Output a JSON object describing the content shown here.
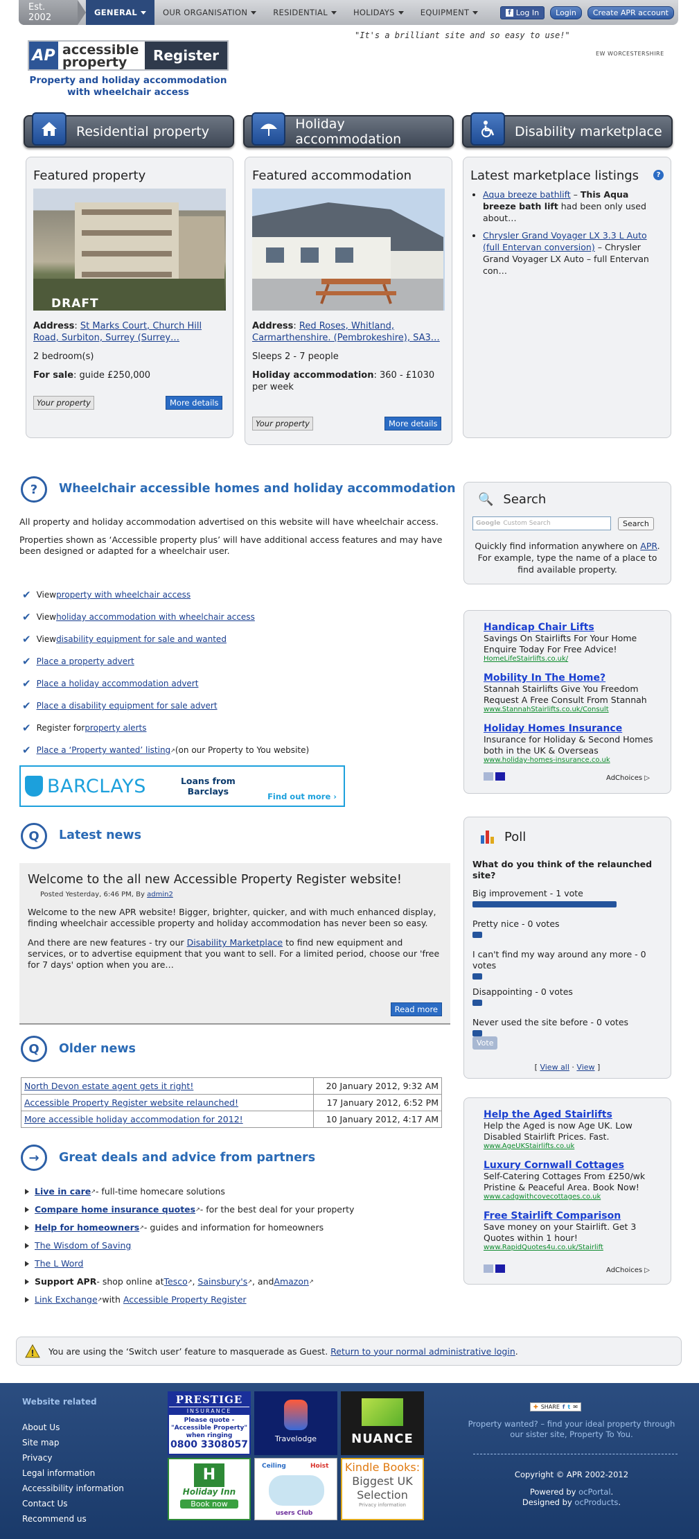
{
  "topnav": {
    "est": "Est. 2002",
    "items": [
      {
        "label": "GENERAL"
      },
      {
        "label": "OUR ORGANISATION"
      },
      {
        "label": "RESIDENTIAL"
      },
      {
        "label": "HOLIDAYS"
      },
      {
        "label": "EQUIPMENT"
      }
    ],
    "fb_login": "Log In",
    "login": "Login",
    "create_account": "Create APR account"
  },
  "header": {
    "logo_ap": "AP",
    "logo_line1": "accessible",
    "logo_line2": "property",
    "logo_register": "Register",
    "tagline_1": "Property and holiday accommodation",
    "tagline_2": "with wheelchair access",
    "quote": "\"It's a brilliant site and so easy to use!\"",
    "quote_source": "EW WORCESTERSHIRE"
  },
  "categories": [
    {
      "label": "Residential property",
      "icon": "house-icon"
    },
    {
      "label": "Holiday accommodation",
      "icon": "umbrella-icon"
    },
    {
      "label": "Disability marketplace",
      "icon": "wheelchair-icon"
    }
  ],
  "featured_property": {
    "title": "Featured property",
    "draft": "DRAFT",
    "address_label": "Address",
    "address": "St Marks Court, Church Hill Road, Surbiton, Surrey (Surrey…",
    "bedrooms": "2 bedroom(s)",
    "sale_label": "For sale",
    "sale_value": ": guide £250,000",
    "your_property": "Your property",
    "more": "More details"
  },
  "featured_accommodation": {
    "title": "Featured accommodation",
    "address_label": "Address",
    "address": "Red Roses, Whitland, Carmarthenshire. (Pembrokeshire), SA3…",
    "sleeps": "Sleeps 2 - 7 people",
    "holiday_label": "Holiday accommodation",
    "holiday_value": ": 360 - £1030 per week",
    "your_property": "Your property",
    "more": "More details"
  },
  "marketplace": {
    "title": "Latest marketplace listings",
    "help": "?",
    "items": [
      {
        "link": "Aqua breeze bathlift",
        "sep": " – ",
        "bold": "This Aqua breeze bath lift",
        "rest": " had been only used about…"
      },
      {
        "link": "Chrysler Grand Voyager LX 3.3 L Auto (full Entervan conversion)",
        "sep": " – ",
        "bold": "",
        "rest": "Chrysler Grand Voyager LX Auto – full Entervan con…"
      }
    ]
  },
  "intro": {
    "title": "Wheelchair accessible homes and holiday accommodation",
    "p1": "All property and holiday accommodation advertised on this website will have wheelchair access.",
    "p2": "Properties shown as ‘Accessible property plus’ will have additional access features and may have been designed or adapted for a wheelchair user.",
    "checks": [
      {
        "pre": "View ",
        "link": "property with wheelchair access",
        "post": ""
      },
      {
        "pre": "View ",
        "link": "holiday accommodation with wheelchair access",
        "post": ""
      },
      {
        "pre": "View ",
        "link": "disability equipment for sale and wanted",
        "post": ""
      },
      {
        "pre": "",
        "link": "Place a property advert",
        "post": ""
      },
      {
        "pre": "",
        "link": "Place a holiday accommodation advert",
        "post": ""
      },
      {
        "pre": "",
        "link": "Place a disability equipment for sale advert",
        "post": ""
      },
      {
        "pre": "Register for ",
        "link": "property alerts",
        "post": ""
      },
      {
        "pre": "",
        "link": "Place a ‘Property wanted’ listing",
        "post": " (on our Property to You website)"
      }
    ]
  },
  "barclays": {
    "brand": "BARCLAYS",
    "line1": "Loans from",
    "line2": "Barclays",
    "cta": "Find out more"
  },
  "search": {
    "title": "Search",
    "placeholder": "Custom Search",
    "google": "Google",
    "button": "Search",
    "desc_1": "Quickly find information anywhere on",
    "desc_link": "APR",
    "desc_2": ". For example, type the name of a place to find available property."
  },
  "ads1": [
    {
      "title": "Handicap Chair Lifts",
      "desc": "Savings On Stairlifts For Your Home Enquire Today For Free Advice!",
      "url": "HomeLifeStairlifts.co.uk/"
    },
    {
      "title": "Mobility In The Home?",
      "desc": "Stannah Stairlifts Give You Freedom Request A Free Consult From Stannah",
      "url": "www.StannahStairlifts.co.uk/Consult"
    },
    {
      "title": "Holiday Homes Insurance",
      "desc": "Insurance for Holiday & Second Homes both in the UK & Overseas",
      "url": "www.holiday-homes-insurance.co.uk"
    }
  ],
  "ads2": [
    {
      "title": "Help the Aged Stairlifts",
      "desc": "Help the Aged is now Age UK. Low Disabled Stairlift Prices. Fast.",
      "url": "www.AgeUKStairlifts.co.uk"
    },
    {
      "title": "Luxury Cornwall Cottages",
      "desc": "Self-Catering Cottages From £250/wk Pristine & Peaceful Area. Book Now!",
      "url": "www.cadgwithcovecottages.co.uk"
    },
    {
      "title": "Free Stairlift Comparison",
      "desc": "Save money on your Stairlift. Get 3 Quotes within 1 hour!",
      "url": "www.RapidQuotes4u.co.uk/Stairlift"
    }
  ],
  "adchoices": "AdChoices",
  "news": {
    "title": "Latest news",
    "headline": "Welcome to the all new Accessible Property Register website!",
    "posted": "Posted Yesterday, 6:46 PM, By",
    "author": "admin2",
    "p1": "Welcome to the new APR website! Bigger, brighter, quicker, and with much enhanced display, finding wheelchair accessible property and holiday accommodation has never been so easy.",
    "p2_pre": "And there are new features - try our ",
    "p2_link": "Disability Marketplace",
    "p2_post": " to find new equipment and services, or to advertise equipment that you want to sell. For a limited period, choose our 'free for 7 days' option when you are…",
    "read_more": "Read more"
  },
  "older": {
    "title": "Older news",
    "rows": [
      {
        "title": "North Devon estate agent gets it right!",
        "date": "20 January 2012, 9:32 AM"
      },
      {
        "title": "Accessible Property Register website relaunched!",
        "date": "17 January 2012, 6:52 PM"
      },
      {
        "title": "More accessible holiday accommodation for 2012!",
        "date": "10 January 2012, 4:17 AM"
      }
    ]
  },
  "deals": {
    "title": "Great deals and advice from partners",
    "items": [
      {
        "link": "Live in care",
        "post": " - full-time homecare solutions",
        "bold": true
      },
      {
        "link": "Compare home insurance quotes",
        "post": " - for the best deal for your property",
        "bold": true
      },
      {
        "link": "Help for homeowners",
        "post": " - guides and information for homeowners",
        "bold": true
      },
      {
        "link": "The Wisdom of Saving",
        "post": "",
        "bold": false
      },
      {
        "link": "The L Word",
        "post": "",
        "bold": false
      }
    ],
    "support_label": "Support APR",
    "support_pre": " - shop online at ",
    "tesco": "Tesco",
    "sainsburys": "Sainsbury's",
    "and": ", and ",
    "amazon": "Amazon",
    "link_exchange": "Link Exchange",
    "with": " with ",
    "apr": "Accessible Property Register"
  },
  "poll": {
    "title": "Poll",
    "question": "What do you think of the relaunched site?",
    "options": [
      {
        "label": "Big improvement - 1 vote",
        "fraction": 1
      },
      {
        "label": "Pretty nice - 0 votes",
        "fraction": 0
      },
      {
        "label": "I can't find my way around any more - 0 votes",
        "fraction": 0
      },
      {
        "label": "Disappointing - 0 votes",
        "fraction": 0
      },
      {
        "label": "Never used the site before - 0 votes",
        "fraction": 0
      }
    ],
    "vote": "Vote",
    "view_all": "View all",
    "view": "View"
  },
  "masquerade": {
    "text": "You are using the ‘Switch user’ feature to masquerade as Guest. ",
    "link": "Return to your normal administrative login",
    "end": "."
  },
  "footer": {
    "heading": "Website related",
    "links": [
      "About Us",
      "Site map",
      "Privacy",
      "Legal information",
      "Accessibility information",
      "Contact Us",
      "Recommend us"
    ],
    "prestige": {
      "title": "PRESTIGE",
      "sub": "INSURANCE",
      "l1": "Please quote -",
      "l2": "\"Accessible Property\"",
      "l3": "when ringing",
      "phone": "0800 3308057"
    },
    "travelodge": "Travelodge",
    "nuance": "NUANCE",
    "holiday_inn": "Holiday Inn",
    "book_now": "Book now",
    "ceiling": "Ceiling",
    "hoist": "Hoist",
    "users_club": "users Club",
    "kindle_1": "Kindle Books:",
    "kindle_2": "Biggest UK",
    "kindle_3": "Selection",
    "privacy_info": "Privacy information",
    "share": "SHARE",
    "wanted_link": "Property wanted?",
    "wanted_text": " – find your ideal property through our sister site, Property To You.",
    "copyright": "Copyright © APR 2002-2012",
    "powered_pre": "Powered by ",
    "powered": "ocPortal",
    "designed_pre": "Designed by ",
    "designed": "ocProducts"
  }
}
